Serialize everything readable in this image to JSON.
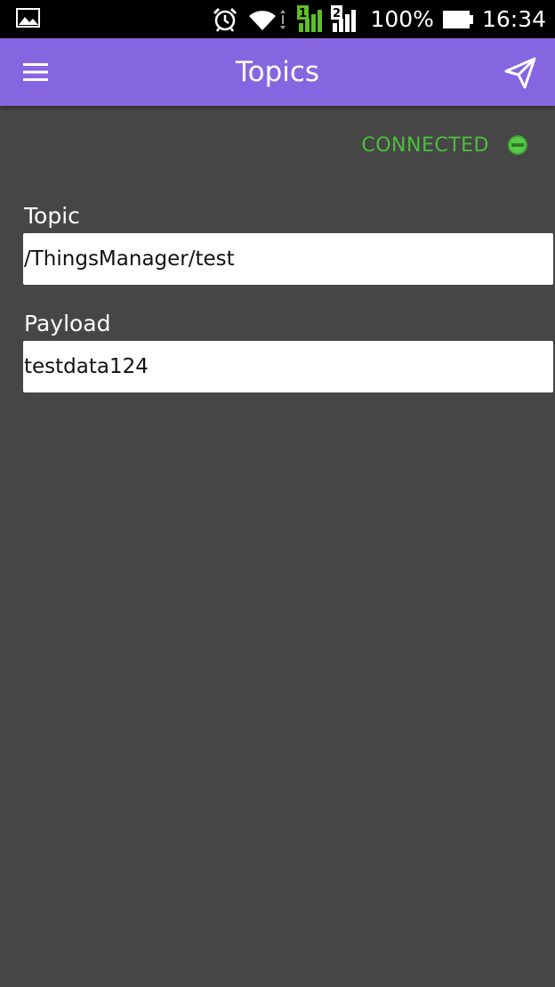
{
  "status_bar": {
    "battery_text": "100%",
    "time": "16:34",
    "sim1_label": "1",
    "sim2_label": "2",
    "icons": [
      "gallery-icon",
      "alarm-icon",
      "wifi-icon",
      "signal-sim1-icon",
      "signal-sim2-icon",
      "battery-icon"
    ]
  },
  "app_bar": {
    "title": "Topics",
    "background_color": "#8666e0",
    "icons": [
      "menu-icon",
      "send-icon"
    ]
  },
  "connection": {
    "label": "CONNECTED",
    "color": "#4bbf3c",
    "indicator_icon": "status-dot-icon"
  },
  "form": {
    "topic": {
      "label": "Topic",
      "value": "/ThingsManager/test"
    },
    "payload": {
      "label": "Payload",
      "value": "testdata124"
    }
  },
  "colors": {
    "screen_background": "#464646",
    "status_bar": "#000000",
    "accent": "#8666e0",
    "connected_green": "#4bbf3c"
  }
}
